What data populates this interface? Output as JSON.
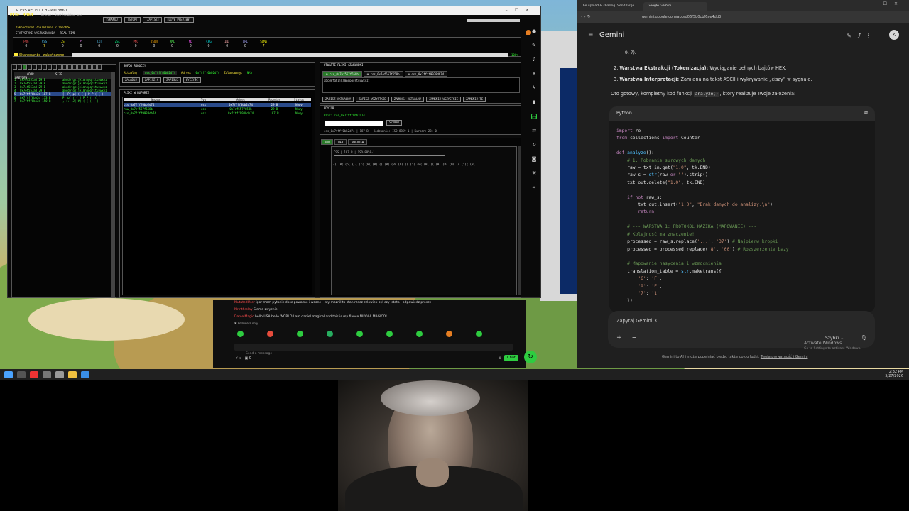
{
  "app": {
    "title": "R EVS REI ELT CH - PID 3860",
    "pid_label": "PID: 3860",
    "process_label": "Proces: RootfasWeber.exe",
    "toolbar": [
      "[SKANUJ]",
      "[STOP]",
      "[ZAPISZ]",
      "[LIVE PREVIEW]"
    ],
    "status_lines": [
      "Zakończono! Znaleziono 7 zasobów",
      "STATYSTYKI WYSZUKIWANIA - REAL-TIME"
    ],
    "stats_labels": [
      "PRG",
      "CSS",
      "JS",
      "PY",
      "TXT",
      "ZSC",
      "PNG",
      "JSON",
      "XML",
      "MD",
      "CFG",
      "INI",
      "URL",
      "SUMA"
    ],
    "stats_values": [
      "0",
      "7",
      "0",
      "0",
      "0",
      "0",
      "0",
      "0",
      "0",
      "0",
      "0",
      "0",
      "0",
      "7"
    ],
    "scan_done": "Skanowanie zakończone!",
    "left_panel": {
      "headers": [
        "ADDR",
        "SIZE",
        "PREVIEW"
      ],
      "rows": [
        [
          "1",
          "0x7ef557a0 29 B",
          "abcdefghijklmnopqrstuvwxyz"
        ],
        [
          "2",
          "0x7ef557a0 29 B",
          "abcdefghijklmnopqrstuvwxyz"
        ],
        [
          "3",
          "0x7ef557a0 29 B",
          "abcdefghijklmnopqrstuvwxyz"
        ],
        [
          "4",
          "0x7ef557a0 29 B",
          "abcdefghijklmnopqrstuvwxyz"
        ],
        [
          "5",
          "0x7ffff0bb2d 187 B",
          "[! P( p( ( { | P P ( ( ("
        ],
        [
          "6",
          "0x7ffff0bb2d 113 B",
          "P( p( ( { | P P ( (( ("
        ],
        [
          "7",
          "0x7ffff0bb2d 150 B",
          ", (+| J( #( ( ( ( ( ("
        ]
      ]
    },
    "buffer": {
      "title": "BUFOR ROBOCZY",
      "fields": [
        "Aktualny:",
        "css_0x7ffff0bb2d74",
        "Adres:",
        "0x7ffff0bb2d74",
        "Zaladowany:",
        "N/A"
      ],
      "buttons": [
        "ZAŁADUJ",
        "ZAPISZ A",
        "ZAPISUJ",
        "WYCZYŚĆ"
      ]
    },
    "files_panel": {
      "title": "PLIKI W BUFORZE",
      "headers": [
        "Nazwa",
        "Typ",
        "Adres",
        "Rozmiar",
        "Status"
      ],
      "rows": [
        [
          "css_0x7ffff0bb2d74",
          "css",
          "0x7ffff0bb2d74",
          "29 B",
          "Nowy"
        ],
        [
          "raw_0x7ef557f658b",
          "css",
          "0x7ef557f658b",
          "29 B",
          "Nowy"
        ],
        [
          "css_0x7ffff9938db74",
          "css",
          "0x7ffff9938db74",
          "187 B",
          "Nowy"
        ]
      ]
    },
    "open_files": {
      "title": "OTWARTE PLIKI (ZAKŁADKI)",
      "tabs": [
        "css_0x7ef557f658b",
        "css_0x7ef557f658b",
        "css_0x7ffff9938db74"
      ],
      "preview": "abcdefghijklmnopqrstuvwxyz{}",
      "buttons": [
        "ZAPISZ AKTUALNY",
        "ZAPISZ WSZYSTKIE",
        "ZAMKNIJ AKTUALNY",
        "ZAMKNIJ WSZYSTKIE",
        "ZAMKNIJ TE"
      ]
    },
    "editor": {
      "title": "EDYTOR",
      "file_label": "Plik: css_0x7ffff0bb2d74",
      "search_button": "SZUKAJ",
      "status": "css_0x7ffff0bb2d74 | 187 B | Kodowanie: ISO-8859-1 | Kursor: 23: 0",
      "tabs": [
        "KOD",
        "HEX",
        "PREVIEW"
      ],
      "info": "CSS | 187 B | ISO-8859-1",
      "content": "{( (P( (p( { { (\"( (B( (R( (( (B( (P( (Q( (( (\"( (B( (B( (( (B( (P( (Q( (( (\")( (B("
    }
  },
  "chat": {
    "lines": [
      {
        "name": "MutatedUser",
        "text": "igor mam pytanie dosc powazne i wazne - czy moznil to stan rzecz czlowiek byl czy istota . odpowiedz prosze"
      },
      {
        "name": "MrInthrelay",
        "text": "Slama zwycnie"
      },
      {
        "name": "DanielMagic",
        "text": "hello USA hello WORLD I am daniel magical and this is my fiance NIKOLA MAGICO!"
      }
    ],
    "followers_only": "Followers only",
    "placeholder": "Send a message",
    "points": "0",
    "chat_button": "Chat",
    "likes": "0"
  },
  "gemini": {
    "tabs": [
      "The upload & sharing. Send large ...",
      "Google Gemini"
    ],
    "url": "gemini.google.com/app/d06f5b0cbf6ae4dd3",
    "brand": "Gemini",
    "intro_fragment": "9, 7).",
    "list": [
      {
        "num": "2.",
        "bold": "Warstwa Ekstrakcji (Tokenizacja):",
        "rest": "Wyciąganie pełnych bajtów HEX."
      },
      {
        "num": "3.",
        "bold": "Warstwa Interpretacji:",
        "rest": "Zamiana na tekst ASCII i wykrywanie „ciszy” w sygnale."
      }
    ],
    "summary_before": "Oto gotowy, kompletny kod funkcji ",
    "summary_code": "analyze()",
    "summary_after": ", który realizuje Twoje założenia:",
    "code_language": "Python",
    "input_placeholder": "Zapytaj Gemini 3",
    "model": "Szybki",
    "disclaimer": "Gemini to AI i może popełniać błędy, także co do ludzi.",
    "privacy_link": "Twoja prywatność i Gemini",
    "activate_title": "Activate Windows",
    "activate_sub": "Go to Settings to activate Windows.",
    "avatar": "K"
  },
  "taskbar": {
    "time": "2:32 PM",
    "date": "5/27/2026"
  }
}
